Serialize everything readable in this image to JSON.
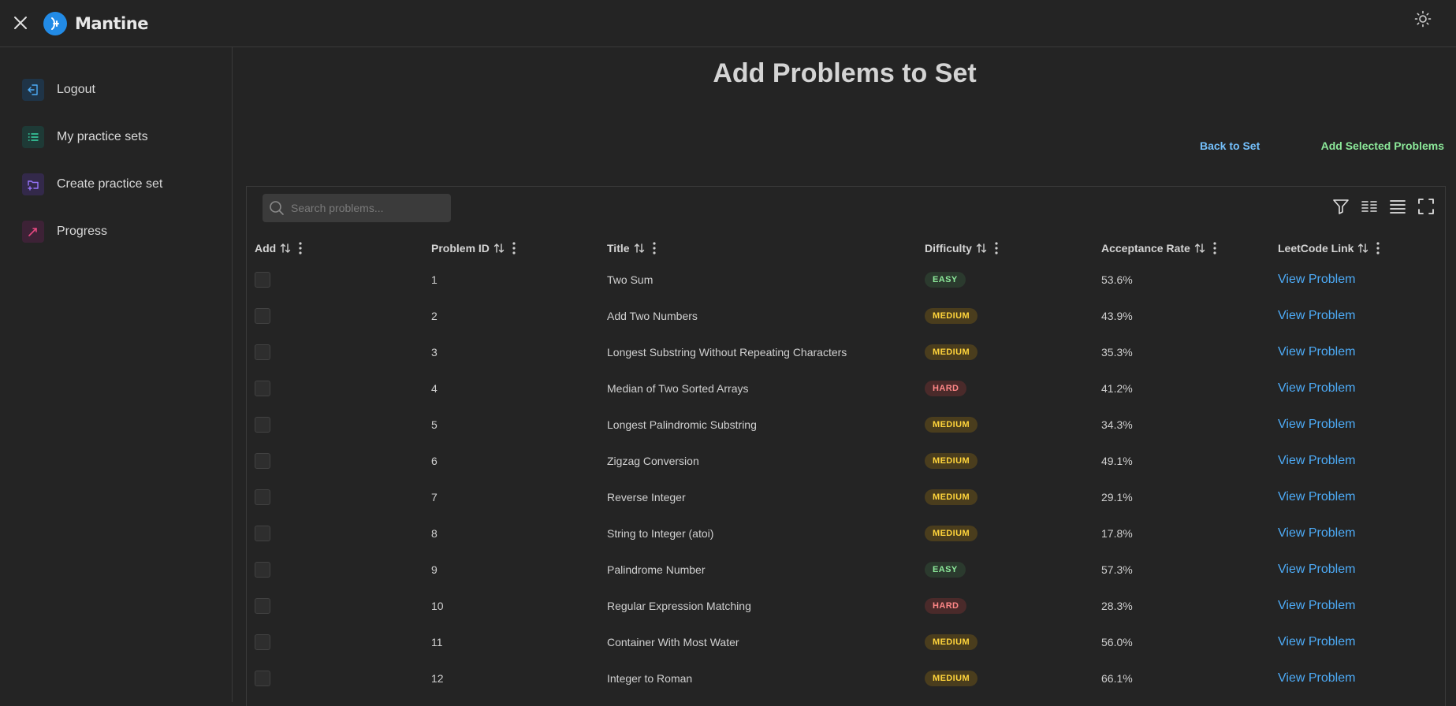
{
  "header": {
    "brand": "Mantine"
  },
  "sidebar": {
    "items": [
      {
        "label": "Logout",
        "icon": "logout-icon",
        "color": "#4dabf7",
        "bg": "#1f3447"
      },
      {
        "label": "My practice sets",
        "icon": "list-icon",
        "color": "#38d9a9",
        "bg": "#1e3a36"
      },
      {
        "label": "Create practice set",
        "icon": "folder-plus-icon",
        "color": "#9775fa",
        "bg": "#33294a"
      },
      {
        "label": "Progress",
        "icon": "trending-icon",
        "color": "#e64980",
        "bg": "#3d2236"
      }
    ]
  },
  "main": {
    "title": "Add Problems to Set",
    "back_label": "Back to Set",
    "add_label": "Add Selected Problems"
  },
  "table": {
    "search_placeholder": "Search problems...",
    "columns": [
      "Add",
      "Problem ID",
      "Title",
      "Difficulty",
      "Acceptance Rate",
      "LeetCode Link"
    ],
    "rows": [
      {
        "id": "1",
        "title": "Two Sum",
        "difficulty": "EASY",
        "rate": "53.6%",
        "link": "View Problem"
      },
      {
        "id": "2",
        "title": "Add Two Numbers",
        "difficulty": "MEDIUM",
        "rate": "43.9%",
        "link": "View Problem"
      },
      {
        "id": "3",
        "title": "Longest Substring Without Repeating Characters",
        "difficulty": "MEDIUM",
        "rate": "35.3%",
        "link": "View Problem"
      },
      {
        "id": "4",
        "title": "Median of Two Sorted Arrays",
        "difficulty": "HARD",
        "rate": "41.2%",
        "link": "View Problem"
      },
      {
        "id": "5",
        "title": "Longest Palindromic Substring",
        "difficulty": "MEDIUM",
        "rate": "34.3%",
        "link": "View Problem"
      },
      {
        "id": "6",
        "title": "Zigzag Conversion",
        "difficulty": "MEDIUM",
        "rate": "49.1%",
        "link": "View Problem"
      },
      {
        "id": "7",
        "title": "Reverse Integer",
        "difficulty": "MEDIUM",
        "rate": "29.1%",
        "link": "View Problem"
      },
      {
        "id": "8",
        "title": "String to Integer (atoi)",
        "difficulty": "MEDIUM",
        "rate": "17.8%",
        "link": "View Problem"
      },
      {
        "id": "9",
        "title": "Palindrome Number",
        "difficulty": "EASY",
        "rate": "57.3%",
        "link": "View Problem"
      },
      {
        "id": "10",
        "title": "Regular Expression Matching",
        "difficulty": "HARD",
        "rate": "28.3%",
        "link": "View Problem"
      },
      {
        "id": "11",
        "title": "Container With Most Water",
        "difficulty": "MEDIUM",
        "rate": "56.0%",
        "link": "View Problem"
      },
      {
        "id": "12",
        "title": "Integer to Roman",
        "difficulty": "MEDIUM",
        "rate": "66.1%",
        "link": "View Problem"
      }
    ]
  },
  "colors": {
    "background": "#242424",
    "brand": "#228be6",
    "link": "#4dabf7",
    "add_button": "#8ce99a",
    "back_button": "#74c0fc"
  }
}
